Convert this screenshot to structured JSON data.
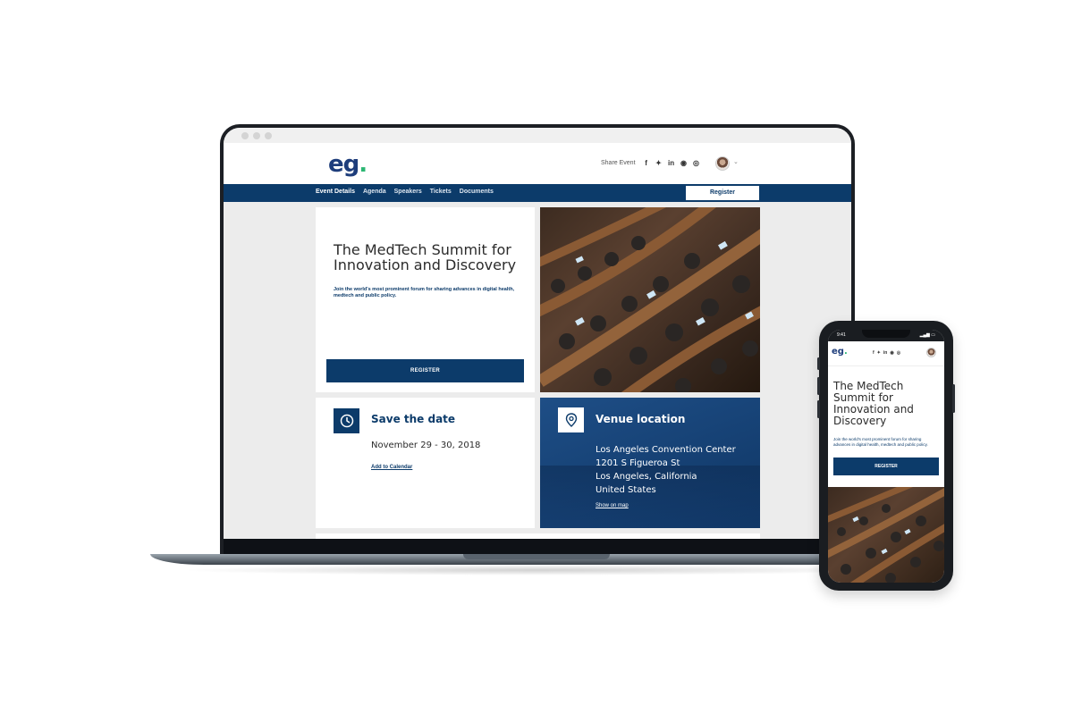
{
  "site": {
    "logo_text": "eg",
    "logo_dot": ".",
    "share_label": "Share Event",
    "social_icons": [
      {
        "name": "facebook-icon",
        "glyph": "f"
      },
      {
        "name": "twitter-icon",
        "glyph": "✦"
      },
      {
        "name": "linkedin-icon",
        "glyph": "in"
      },
      {
        "name": "wechat-icon",
        "glyph": "◉"
      },
      {
        "name": "weibo-icon",
        "glyph": "◎"
      }
    ],
    "avatar_caret": "⌄"
  },
  "nav": {
    "items": [
      {
        "label": "Event Details",
        "active": true
      },
      {
        "label": "Agenda",
        "active": false
      },
      {
        "label": "Speakers",
        "active": false
      },
      {
        "label": "Tickets",
        "active": false
      },
      {
        "label": "Documents",
        "active": false
      }
    ],
    "register_label": "Register"
  },
  "hero": {
    "title": "The MedTech Summit for Innovation and Discovery",
    "subtitle": "Join the world's most prominent forum for sharing advances in digital health, medtech and public policy.",
    "button_label": "REGISTER"
  },
  "date_card": {
    "title": "Save the date",
    "date": "November 29 - 30, 2018",
    "link_label": "Add to Calendar"
  },
  "venue_card": {
    "title": "Venue location",
    "lines": [
      "Los Angeles Convention Center",
      "1201 S Figueroa St",
      "Los Angeles, California",
      "United States"
    ],
    "link_label": "Show on map"
  },
  "phone": {
    "time": "9:41",
    "signal": "▂▄▆ ▭",
    "logo_text": "eg",
    "logo_dot": ".",
    "social_glyphs": [
      "f",
      "✦",
      "in",
      "◉",
      "◎"
    ],
    "title": "The MedTech Summit for Innovation and Discovery",
    "subtitle": "Join the world's most prominent forum for sharing advances in digital health, medtech and public policy.",
    "button_label": "REGISTER"
  },
  "colors": {
    "navy": "#0c3b6a",
    "logo_blue": "#1e3d7b",
    "logo_green": "#2bb673",
    "page_bg": "#ececec"
  }
}
